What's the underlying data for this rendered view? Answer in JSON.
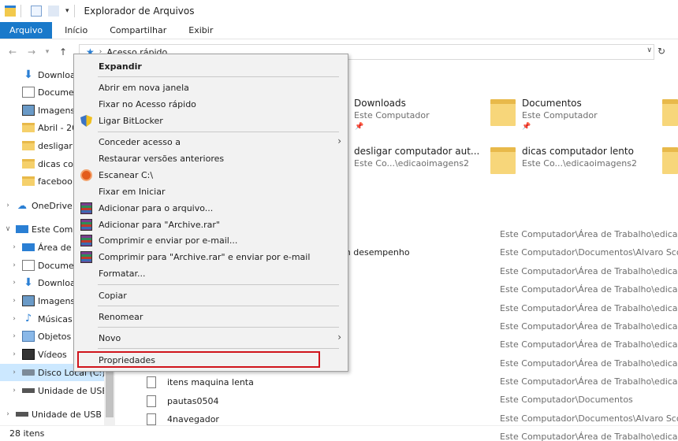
{
  "window": {
    "title": "Explorador de Arquivos"
  },
  "ribbon": {
    "tabs": [
      "Arquivo",
      "Início",
      "Compartilhar",
      "Exibir"
    ]
  },
  "address": {
    "path": "Acesso rápido"
  },
  "sidebar": {
    "items": [
      {
        "label": "Downloa",
        "icon": "download-icon"
      },
      {
        "label": "Docume",
        "icon": "document-icon"
      },
      {
        "label": "Imagens",
        "icon": "image-icon"
      },
      {
        "label": "Abril - 20",
        "icon": "folder-icon"
      },
      {
        "label": "desligar",
        "icon": "folder-icon"
      },
      {
        "label": "dicas co",
        "icon": "folder-icon"
      },
      {
        "label": "faceboo",
        "icon": "folder-icon"
      },
      {
        "label": "OneDrive",
        "icon": "cloud-icon"
      },
      {
        "label": "Este Comp",
        "icon": "computer-icon"
      },
      {
        "label": "Área de T",
        "icon": "desktop-icon"
      },
      {
        "label": "Docume",
        "icon": "document-icon"
      },
      {
        "label": "Downloa",
        "icon": "download-icon"
      },
      {
        "label": "Imagens",
        "icon": "image-icon"
      },
      {
        "label": "Músicas",
        "icon": "music-icon"
      },
      {
        "label": "Objetos",
        "icon": "cube-icon"
      },
      {
        "label": "Vídeos",
        "icon": "video-icon"
      },
      {
        "label": "Disco Local (C:)",
        "icon": "drive-icon"
      },
      {
        "label": "Unidade de USB",
        "icon": "usb-icon"
      },
      {
        "label": "Unidade de USB (I",
        "icon": "usb-icon"
      }
    ]
  },
  "tiles": [
    {
      "name": "Downloads",
      "sub": "Este Computador"
    },
    {
      "name": "Documentos",
      "sub": "Este Computador"
    },
    {
      "name": "desligar computador aut...",
      "sub": "Este Co...\\edicaoimagens2"
    },
    {
      "name": "dicas computador lento",
      "sub": "Este Co...\\edicaoimagens2"
    }
  ],
  "recent": {
    "paths": [
      "Este Computador\\Área de Trabalho\\edicaoim",
      "Este Computador\\Documentos\\Alvaro Scola",
      "Este Computador\\Área de Trabalho\\edicaoim",
      "Este Computador\\Área de Trabalho\\edicaoim",
      "Este Computador\\Área de Trabalho\\edicaoim",
      "Este Computador\\Área de Trabalho\\edicaoim",
      "Este Computador\\Área de Trabalho\\edicaoim",
      "Este Computador\\Área de Trabalho\\edicaoim",
      "Este Computador\\Área de Trabalho\\edicaoim",
      "Este Computador\\Documentos",
      "Este Computador\\Documentos\\Alvaro Scola",
      "Este Computador\\Área de Trabalho\\edicaoim"
    ],
    "partial_name": "m desempenho",
    "files": [
      "itens maquina lenta",
      "pautas0504",
      "4navegador"
    ]
  },
  "context_menu": {
    "expand": "Expandir",
    "open_new_window": "Abrir em nova janela",
    "pin_quick_access": "Fixar no Acesso rápido",
    "bitlocker": "Ligar BitLocker",
    "grant_access": "Conceder acesso a",
    "restore_versions": "Restaurar versões anteriores",
    "scan": "Escanear C:\\",
    "pin_start": "Fixar em Iniciar",
    "add_to_archive": "Adicionar para o arquivo...",
    "add_to_rar": "Adicionar para \"Archive.rar\"",
    "compress_email": "Comprimir e enviar por e-mail...",
    "compress_rar_email": "Comprimir para \"Archive.rar\" e enviar por e-mail",
    "format": "Formatar...",
    "copy": "Copiar",
    "rename": "Renomear",
    "new": "Novo",
    "properties": "Propriedades"
  },
  "status": {
    "items_count": "28 itens"
  },
  "colors": {
    "accent": "#1979ca",
    "highlight_border": "#d0141c",
    "selection": "#cce8ff"
  }
}
